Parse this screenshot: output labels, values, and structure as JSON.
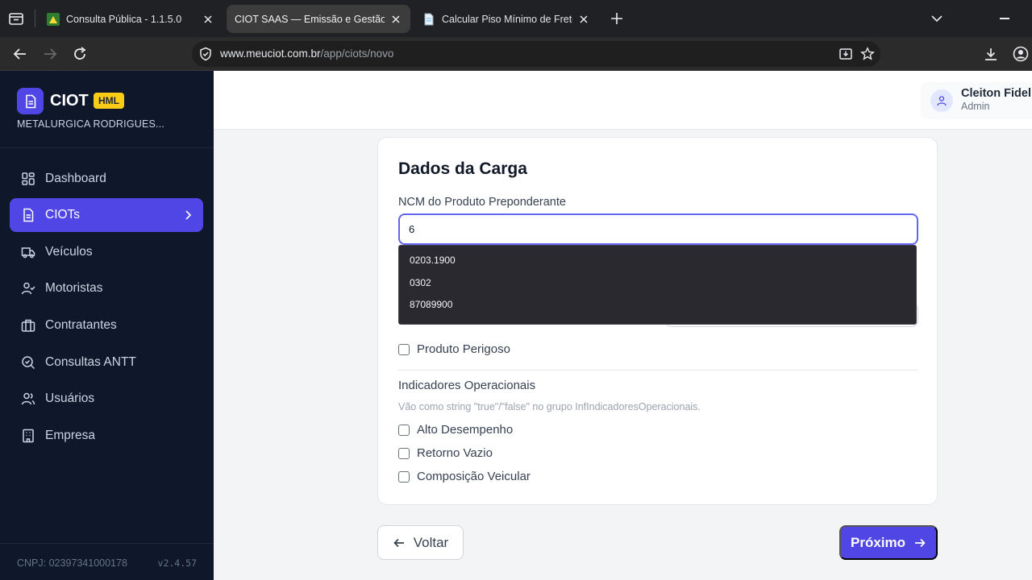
{
  "browser": {
    "tabs": [
      {
        "title": "Consulta Pública - 1.1.5.0",
        "favicon": "green-leaf-icon"
      },
      {
        "title": "CIOT SAAS — Emissão e Gestão de CIOT",
        "favicon": "none",
        "active": true
      },
      {
        "title": "Calcular Piso Mínimo de Frete - ANTT",
        "favicon": "document-icon"
      }
    ],
    "url_host": "www.meuciot.com.br",
    "url_path": "/app/ciots/novo"
  },
  "sidebar": {
    "brand": "CIOT",
    "env_badge": "HML",
    "company": "METALURGICA RODRIGUES...",
    "items": [
      {
        "label": "Dashboard",
        "icon": "grid-icon"
      },
      {
        "label": "CIOTs",
        "icon": "document-icon",
        "active": true
      },
      {
        "label": "Veículos",
        "icon": "truck-icon"
      },
      {
        "label": "Motoristas",
        "icon": "user-check-icon"
      },
      {
        "label": "Contratantes",
        "icon": "briefcase-icon"
      },
      {
        "label": "Consultas ANTT",
        "icon": "search-icon"
      },
      {
        "label": "Usuários",
        "icon": "users-icon"
      },
      {
        "label": "Empresa",
        "icon": "building-icon"
      }
    ],
    "cnpj": "CNPJ: 02397341000178",
    "version": "v2.4.57"
  },
  "header": {
    "user_name": "Cleiton Fideli",
    "user_role": "Admin"
  },
  "form": {
    "title": "Dados da Carga",
    "ncm_label": "NCM do Produto Preponderante",
    "ncm_value": "6",
    "ncm_suggestions": [
      "0203.1900",
      "0302",
      "87089900"
    ],
    "dangerous_label": "Produto Perigoso",
    "indicators_title": "Indicadores Operacionais",
    "indicators_help": "Vão como string \"true\"/\"false\" no grupo InfIndicadoresOperacionais.",
    "indicators": [
      "Alto Desempenho",
      "Retorno Vazio",
      "Composição Veicular"
    ]
  },
  "actions": {
    "back_label": "Voltar",
    "next_label": "Próximo"
  },
  "colors": {
    "primary": "#4f46e5",
    "sidebar_bg": "#0f172a",
    "badge": "#facc15"
  }
}
